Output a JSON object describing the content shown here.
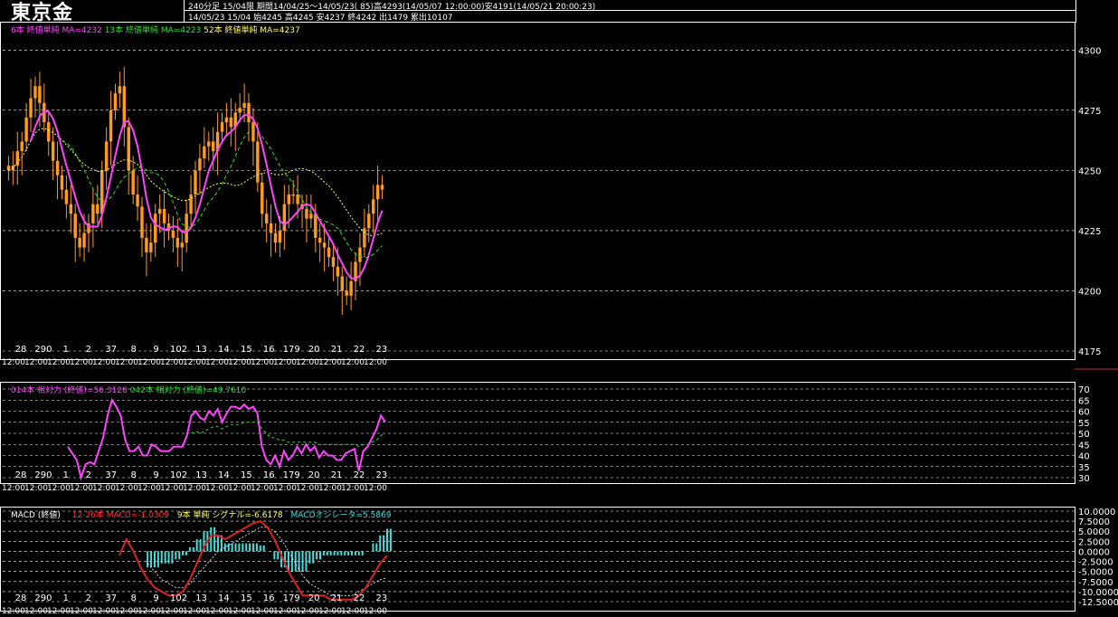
{
  "header": {
    "title": "東京金",
    "line1": "240分足 15/04限  期間14/04/25～14/05/23( 85)高4293(14/05/07 12:00:00)安4191(14/05/21 20:00:23)",
    "line2": "14/05/23 15/04 始4245 高4245 安4237 終4242 出1479 累出10107"
  },
  "legends": {
    "price": [
      {
        "text": "6本 終値単純 MA=4232",
        "color": "#ff44ff"
      },
      {
        "text": "13本 終値単純 MA=4223",
        "color": "#33dd33"
      },
      {
        "text": "52本 終値単純 MA=4237",
        "color": "#ffff66"
      }
    ],
    "rsi": [
      {
        "text": "014本 相対力 (終値)=56.3128",
        "color": "#ff44ff"
      },
      {
        "text": "042本 相対力 (終値)=49.7610",
        "color": "#33dd33"
      }
    ],
    "macd": [
      {
        "text": "MACD (終値)",
        "color": "#ffffff"
      },
      {
        "text": "12-26本 MACD=-1.0309",
        "color": "#ff3333"
      },
      {
        "text": "9本 単純 シグナル=-6.6178",
        "color": "#ffff66"
      },
      {
        "text": "MACDオシレータ=5.5869",
        "color": "#44dddd"
      }
    ]
  },
  "x_date_labels": [
    "28",
    "290",
    "1",
    "2",
    "37",
    "8",
    "9",
    "102",
    "13",
    "14",
    "15",
    "16",
    "179",
    "20",
    "21",
    "22",
    "23"
  ],
  "x_time_label": "12:00",
  "colors": {
    "candle": "#ff9a1a",
    "wick": "#ff9a1a",
    "ma6": "#ff44ff",
    "ma13": "#33dd33",
    "ma52": "#ffff66",
    "grid": "#ffffff",
    "macd": "#dd2222",
    "osc": "#44dddd"
  },
  "chart_data": [
    {
      "type": "candlestick",
      "title": "東京金 240分足 15/04限",
      "ylim": [
        4175,
        4305
      ],
      "yticks": [
        4300,
        4275,
        4250,
        4225,
        4200,
        4175
      ],
      "close": [
        4250,
        4252,
        4258,
        4262,
        4272,
        4280,
        4285,
        4278,
        4270,
        4262,
        4254,
        4248,
        4242,
        4236,
        4232,
        4222,
        4218,
        4224,
        4228,
        4236,
        4232,
        4250,
        4262,
        4275,
        4282,
        4285,
        4268,
        4250,
        4240,
        4235,
        4222,
        4216,
        4220,
        4232,
        4234,
        4228,
        4225,
        4222,
        4218,
        4220,
        4232,
        4240,
        4250,
        4255,
        4260,
        4262,
        4258,
        4266,
        4270,
        4272,
        4268,
        4274,
        4276,
        4278,
        4270,
        4262,
        4245,
        4232,
        4228,
        4224,
        4220,
        4225,
        4236,
        4240,
        4240,
        4236,
        4234,
        4230,
        4232,
        4222,
        4220,
        4218,
        4214,
        4210,
        4206,
        4200,
        4198,
        4204,
        4212,
        4218,
        4226,
        4232,
        4238,
        4244,
        4242
      ],
      "ma6": [],
      "ma13": [],
      "ma52": []
    },
    {
      "type": "line",
      "title": "相対力",
      "ylim": [
        30,
        70
      ],
      "yticks": [
        70,
        65,
        60,
        55,
        50,
        45,
        40,
        35,
        30
      ],
      "series": [
        {
          "name": "014本 相対力",
          "values": [
            44,
            41,
            38,
            30,
            36,
            37,
            36,
            42,
            48,
            58,
            65,
            62,
            58,
            47,
            42,
            42,
            44,
            40,
            40,
            45,
            44,
            42,
            42,
            42,
            44,
            44,
            44,
            49,
            58,
            60,
            57,
            56,
            60,
            58,
            61,
            55,
            59,
            62,
            62,
            61,
            63,
            61,
            62,
            59,
            44,
            38,
            36,
            40,
            35,
            42,
            38,
            40,
            44,
            41,
            45,
            42,
            44,
            39,
            42,
            40,
            40,
            38,
            38,
            41,
            42,
            43,
            33,
            42,
            44,
            48,
            52,
            58,
            55
          ]
        },
        {
          "name": "042本 相対力",
          "values": [
            null,
            null,
            null,
            null,
            null,
            null,
            null,
            null,
            null,
            null,
            null,
            null,
            null,
            null,
            null,
            null,
            null,
            null,
            null,
            null,
            null,
            null,
            null,
            null,
            null,
            null,
            null,
            null,
            50,
            51,
            50,
            51,
            52,
            53,
            53,
            52,
            53,
            54,
            54,
            54,
            55,
            55,
            55,
            55,
            52,
            50,
            48,
            48,
            47,
            47,
            46,
            46,
            46,
            46,
            46,
            46,
            46,
            45,
            45,
            45,
            45,
            45,
            45,
            45,
            45,
            45,
            44,
            45,
            45,
            46,
            47,
            49,
            50
          ]
        }
      ]
    },
    {
      "type": "bar+line",
      "title": "MACD (終値)",
      "ylim": [
        -12.5,
        10
      ],
      "yticks": [
        10,
        7.5,
        5,
        2.5,
        0,
        -2.5,
        -5,
        -7.5,
        -10,
        -12.5
      ],
      "series": [
        {
          "name": "12-26本 MACD",
          "values": [
            -1,
            3,
            0,
            -4,
            -7,
            -9,
            -10,
            -11,
            -11,
            -10,
            -7,
            -3,
            1,
            4,
            4,
            3,
            4,
            5,
            6,
            7,
            7.5,
            6,
            3,
            -1,
            -5,
            -8,
            -11,
            -11,
            -11,
            -11,
            -12,
            -12,
            -12,
            -12,
            -11,
            -9,
            -6,
            -3,
            -1
          ]
        },
        {
          "name": "9本 単純 シグナル",
          "values": [
            null,
            null,
            null,
            null,
            -3,
            -5,
            -7,
            -8,
            -9,
            -9,
            -8,
            -6,
            -4,
            -2,
            0,
            1,
            2,
            3,
            4,
            5,
            6,
            6,
            5,
            3,
            0,
            -3,
            -6,
            -8,
            -9,
            -10,
            -11,
            -11,
            -11,
            -11,
            -10,
            -9,
            -8,
            -7,
            -6.6
          ]
        },
        {
          "name": "MACDオシレータ",
          "values": [
            null,
            null,
            null,
            null,
            -4,
            -4,
            -3,
            -3,
            -2,
            -1,
            1,
            3,
            5,
            6,
            4,
            2,
            2,
            2,
            2,
            2,
            1.5,
            0,
            -2,
            -4,
            -5,
            -5,
            -5,
            -3,
            -2,
            -1,
            -1,
            -1,
            -1,
            -1,
            -1,
            0,
            2,
            4,
            5.6
          ]
        }
      ]
    }
  ]
}
